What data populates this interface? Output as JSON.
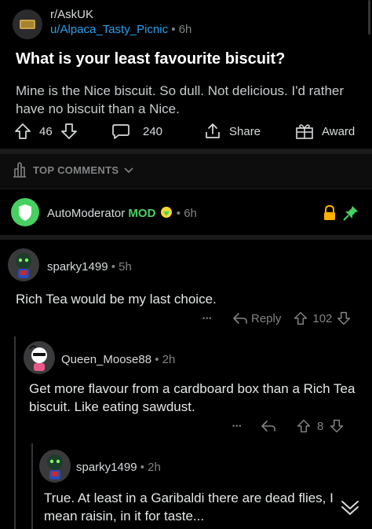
{
  "post": {
    "subreddit": "r/AskUK",
    "author": "u/Alpaca_Tasty_Picnic",
    "age": "6h",
    "title": "What is your least favourite biscuit?",
    "body": "Mine is the Nice biscuit. So dull. Not delicious. I'd rather have no biscuit than a Nice.",
    "votes": "46",
    "comments": "240",
    "share_label": "Share",
    "award_label": "Award"
  },
  "sort": {
    "label": "TOP COMMENTS"
  },
  "mod_comment": {
    "author": "AutoModerator",
    "badge": "MOD",
    "age": "6h"
  },
  "comments": [
    {
      "author": "sparky1499",
      "age": "5h",
      "text": "Rich Tea would be my last choice.",
      "reply_label": "Reply",
      "votes": "102"
    },
    {
      "author": "Queen_Moose88",
      "age": "2h",
      "text": "Get more flavour from a cardboard box than a Rich Tea biscuit. Like eating sawdust.",
      "votes": "8"
    },
    {
      "author": "sparky1499",
      "age": "2h",
      "text": "True. At least in a Garibaldi there are dead flies, I mean raisin, in it for taste..."
    }
  ],
  "separator": "•",
  "more_glyph": "•••",
  "colors": {
    "background": "#000000",
    "link": "#24a0ed",
    "mod_green": "#46d160",
    "lock": "#ffb000",
    "divider": "#1a1a1b"
  }
}
